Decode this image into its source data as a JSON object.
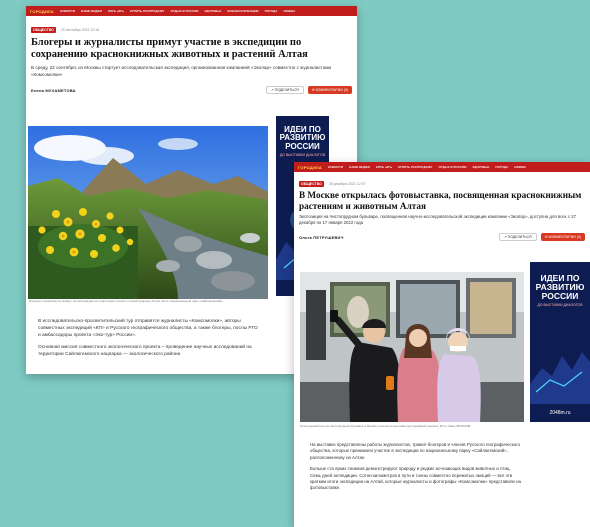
{
  "card1": {
    "nav": {
      "logo": "ГОРОДИЛА",
      "items": [
        "НОВОСТИ",
        "НАШЕ ВИДЕО",
        "КЛУБ «КП»",
        "КУПИТЬ РАСПРОДАЖУ",
        "ОТДЫХ В РОССИИ",
        "ЗДОРОВЬЕ",
        "ВОЕННОСЛУЖАЩИЕ",
        "ПОГОДА",
        "АФИША"
      ]
    },
    "tag": "ОБЩЕСТВО",
    "date": "20 сентября 2022 12:16",
    "title": "Блогеры и журналисты примут участие в экспедиции по сохранению краснокнижных животных и растений Алтая",
    "lead": "В среду, 22 сентября, из Москвы стартует исследовательская экспедиция, организованная компанией «Эколар» совместно с журналистами «Комсомолки»",
    "author": "Елена МУХАМЕТОВА",
    "subscribe": "ПОДЕЛИТЬСЯ",
    "comments": "КОММЕНТАРИИ (0)",
    "caption": "Блогеры и журналисты выйдут на экспедицию на территории горной и горной природы Алтая. Фото: Национальный парк «Сайлюгемский»",
    "paragraphs": [
      "В исследовательско-просветительский тур отправятся журналисты «Комсомолки», авторы совместных экспедиций «КП» и Русского географического общества, а также блогеры, послы РГО и амбассадоры проекта «Эко-тур» России».",
      "Основная миссия совместного экологического проекта – проведение научных исследований на территории Сайлюгемского нацпарка — экологического района"
    ],
    "ad": {
      "title": "ИДЕИ ПО РАЗВИТИЮ РОССИИ",
      "sub": "ДО ВЫСТАВКИ ДИАЛОГОВ"
    }
  },
  "card2": {
    "nav": {
      "logo": "ГОРОДИЛА",
      "items": [
        "НОВОСТИ",
        "НАШЕ ВИДЕО",
        "КЛУБ «КП»",
        "КУПИТЬ РАСПРОДАЖУ",
        "ОТДЫХ В РОССИИ",
        "ЗДОРОВЬЕ",
        "ПОГОДА",
        "АФИША"
      ]
    },
    "tag": "ОБЩЕСТВО",
    "date": "28 декабря 2021 12:57",
    "title": "В Москве открылась фотовыставка, посвященная краснокнижным растениям и животным Алтая",
    "lead": "Экспозиция на Чистопрудном бульваре, посвященная научно-исследовательской экспедиции компании «Эколар», доступна для всех с 27 декабря по 17 января 2022 года",
    "author": "Ольга ПЕТРУШЕВИЧ",
    "subscribe": "ПОДЕЛИТЬСЯ",
    "comments": "КОММЕНТАРИИ (0)",
    "caption": "Присоединяйтесь на Чистопрудном бульваре в Москве и на месте выставки фотографией проекта. Фото: Иван ФИЛАТОВ",
    "paragraphs": [
      "На выставке представлены работы журналистов, травел-блогеров и членов Русского географического общества, которые принимали участие в экспедиции по национальному парку «Сайлюгемский», расположенному на Алтае.",
      "Больше ста ярких снимков демонстрируют природу и редких исчезающих видов животных и птиц. Семь дней экспедиции. Сотни километров в пути и тонны совместно пережитых эмоций — все эти кратким итоги экспедиции на Алтай, которые журналисты и фотографы «Комсомолки» представили на фотовыставке."
    ],
    "ad": {
      "title": "ИДЕИ ПО РАЗВИТИЮ РОССИИ",
      "sub": "ДО ВЫСТАВКИ ДИАЛОГОВ",
      "site": "2048m.ru"
    }
  }
}
